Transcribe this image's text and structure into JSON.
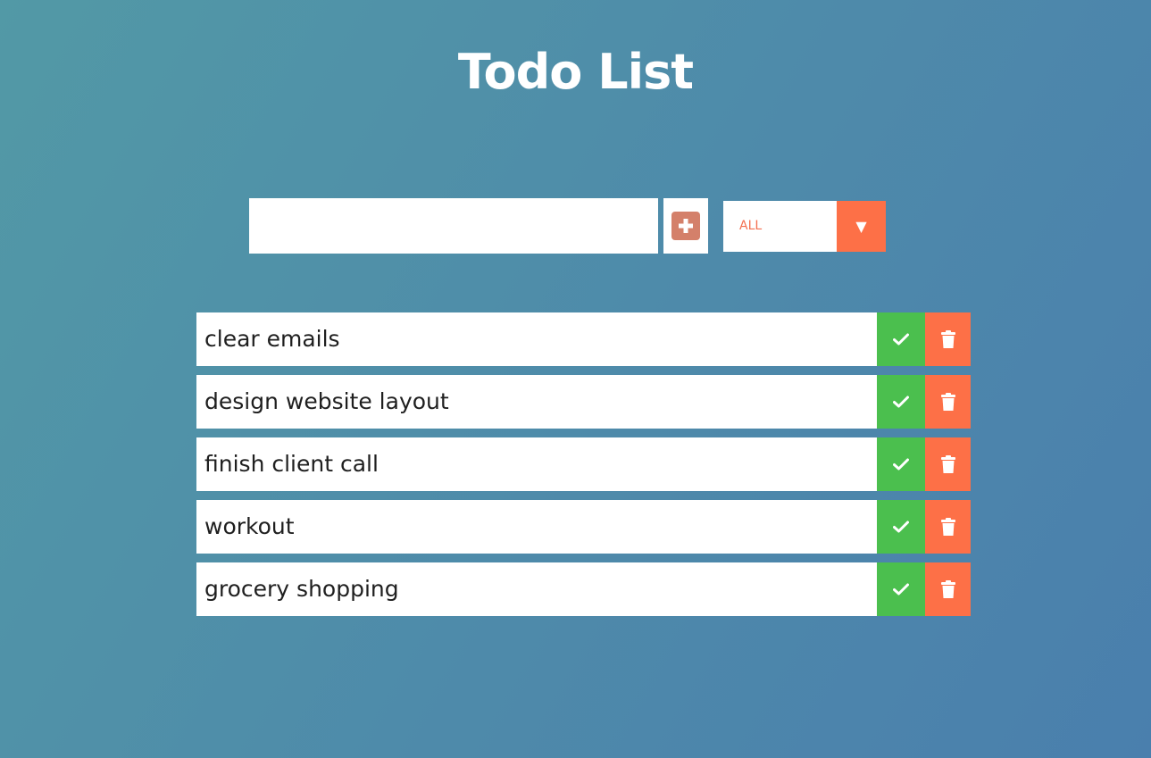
{
  "header": {
    "title": "Todo List"
  },
  "form": {
    "input_value": "",
    "add_icon": "plus-square-icon",
    "filter": {
      "selected": "ALL",
      "arrow_glyph": "▼"
    }
  },
  "todos": [
    {
      "text": "clear emails"
    },
    {
      "text": "design website layout"
    },
    {
      "text": "finish client call"
    },
    {
      "text": "workout"
    },
    {
      "text": "grocery shopping"
    }
  ],
  "icons": {
    "complete": "check-icon",
    "delete": "trash-icon"
  },
  "colors": {
    "accent": "#fd7047",
    "complete": "#4bbf4e",
    "add_icon": "#d4806a",
    "background_start": "#5299a6",
    "background_end": "#4a7fad"
  }
}
